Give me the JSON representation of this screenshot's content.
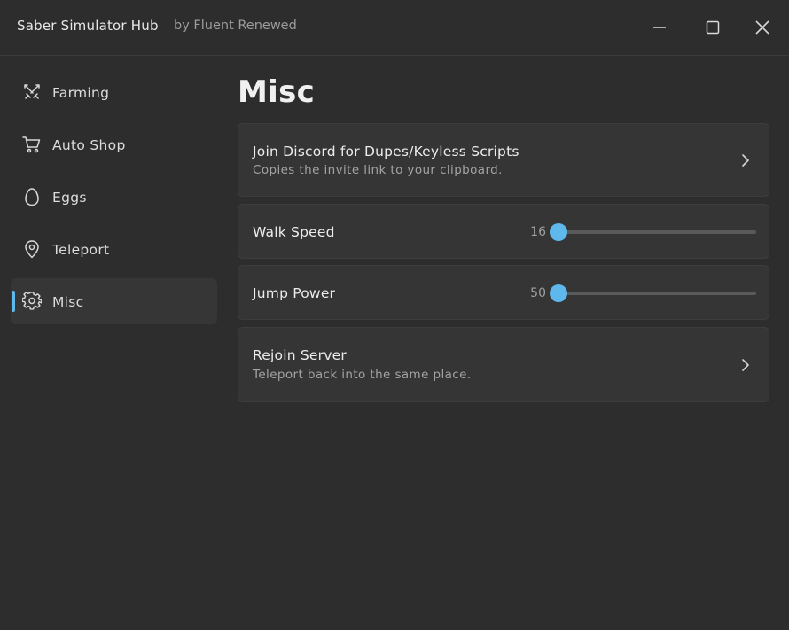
{
  "window": {
    "title": "Saber Simulator Hub",
    "subtitle": "by Fluent Renewed",
    "controls": {
      "minimize_icon": "minimize-icon",
      "maximize_icon": "maximize-icon",
      "close_icon": "close-icon"
    }
  },
  "sidebar": {
    "items": [
      {
        "label": "Farming",
        "icon": "crossed-swords-icon",
        "active": false
      },
      {
        "label": "Auto Shop",
        "icon": "shopping-cart-icon",
        "active": false
      },
      {
        "label": "Eggs",
        "icon": "egg-icon",
        "active": false
      },
      {
        "label": "Teleport",
        "icon": "map-pin-icon",
        "active": false
      },
      {
        "label": "Misc",
        "icon": "gear-icon",
        "active": true
      }
    ]
  },
  "main": {
    "title": "Misc",
    "discord": {
      "title": "Join Discord for Dupes/Keyless Scripts",
      "description": "Copies the invite link to your clipboard."
    },
    "walk_speed": {
      "label": "Walk Speed",
      "value": "16",
      "level": 0.0
    },
    "jump_power": {
      "label": "Jump Power",
      "value": "50",
      "level": 0.0
    },
    "rejoin": {
      "title": "Rejoin Server",
      "description": "Teleport back into the same place."
    }
  },
  "colors": {
    "accent": "#5fb8ec",
    "background": "#2d2d2d",
    "card": "#353535",
    "text": "#ececec",
    "muted_text": "#a3a3a3"
  }
}
